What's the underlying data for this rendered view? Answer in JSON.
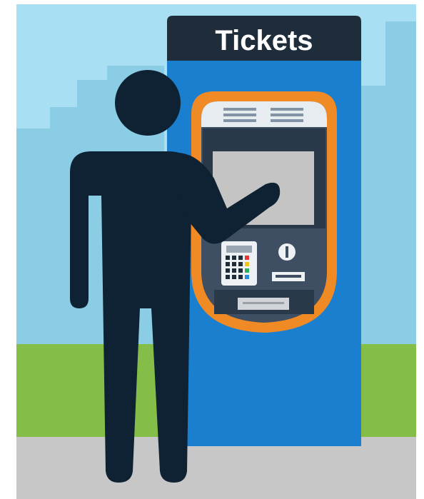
{
  "sign": {
    "label": "Tickets"
  },
  "colors": {
    "sky": "#a9dff2",
    "skyline": "#8bcde4",
    "grass": "#84bd48",
    "pavement": "#c7c7c7",
    "kiosk_body": "#1b7fd0",
    "kiosk_header": "#1f2c3a",
    "bezel": "#f08a25",
    "panel": "#3e4f63",
    "screen": "#c4c4c4",
    "person": "#0e2233",
    "sign_text": "#ffffff"
  },
  "icons": {
    "keypad": "keypad-icon",
    "coin_slot": "coin-slot-icon",
    "card_slot": "card-slot-icon",
    "ticket_dispenser": "ticket-dispenser-icon",
    "speaker_grille": "speaker-grille-icon"
  }
}
